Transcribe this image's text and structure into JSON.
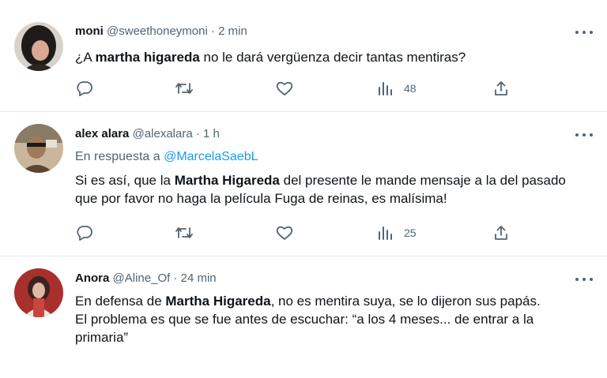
{
  "colors": {
    "text": "#0f1419",
    "muted": "#536471",
    "accent": "#1d9bf0",
    "divider": "#e6e9ec"
  },
  "tweets": [
    {
      "author": "moni",
      "handle": "@sweethoneymoni",
      "time": "· 2 min",
      "text_pre": "¿A ",
      "text_bold": "martha higareda",
      "text_post": " no le dará vergüenza decir tantas mentiras?",
      "views": "48",
      "icons": [
        "reply-icon",
        "retweet-icon",
        "like-icon",
        "views-icon",
        "share-icon"
      ]
    },
    {
      "author": "alex alara",
      "handle": "@alexalara",
      "time": "· 1 h",
      "reply_prefix": "En respuesta a ",
      "reply_to": "@MarcelaSaebL",
      "text_pre": "Si es así,  que la ",
      "text_bold": "Martha Higareda",
      "text_post": " del presente le mande mensaje  a la del pasado que por favor no haga la película Fuga de reinas,  es malísima!",
      "views": "25",
      "icons": [
        "reply-icon",
        "retweet-icon",
        "like-icon",
        "views-icon",
        "share-icon"
      ]
    },
    {
      "author": "Anora",
      "handle": "@Aline_Of",
      "time": "· 24 min",
      "text_pre": "En defensa de ",
      "text_bold": "Martha Higareda",
      "text_post": ", no es mentira suya, se lo dijeron sus papás.",
      "text_line2": "El problema es que se fue antes de escuchar: “a los 4 meses... de entrar a la primaria”"
    }
  ]
}
